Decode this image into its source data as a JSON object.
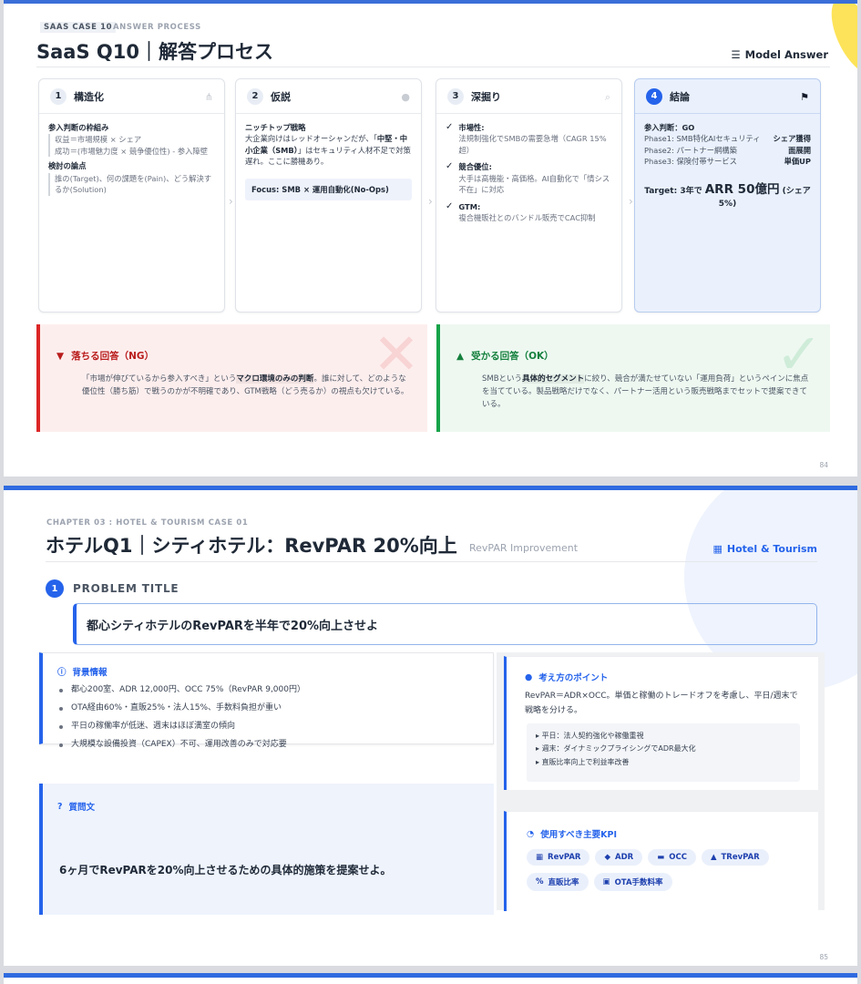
{
  "slide1": {
    "kicker_a": "SAAS CASE 10",
    "kicker_b": "ANSWER PROCESS",
    "title": "SaaS Q10｜解答プロセス",
    "model_answer": "Model Answer",
    "cards": [
      {
        "num": "1",
        "title": "構造化",
        "icon": "sitemap-icon"
      },
      {
        "num": "2",
        "title": "仮説",
        "icon": "lightbulb-icon"
      },
      {
        "num": "3",
        "title": "深掘り",
        "icon": "search-icon"
      },
      {
        "num": "4",
        "title": "結論",
        "icon": "flag-icon"
      }
    ],
    "c1": {
      "h1": "参入判断の枠組み",
      "l1": "収益＝市場規模 × シェア",
      "l2": "成功＝(市場魅力度 × 競争優位性) - 参入障壁",
      "h2": "検討の論点",
      "l3": "誰の(Target)、何の課題を(Pain)、どう解決するか(Solution)"
    },
    "c2": {
      "h1": "ニッチトップ戦略",
      "text_a": "大企業向けはレッドオーシャンだが、「",
      "text_b": "中堅・中小企業（SMB）",
      "text_c": "」はセキュリティ人材不足で対策遅れ。ここに勝機あり。",
      "focus": "Focus: SMB × 運用自動化(No-Ops)"
    },
    "c3": {
      "items": [
        {
          "title": "市場性:",
          "text": "法規制強化でSMBの需要急増（CAGR 15%超）"
        },
        {
          "title": "競合優位:",
          "text": "大手は高機能・高価格。AI自動化で「情シス不在」に対応"
        },
        {
          "title": "GTM:",
          "text": "複合機販社とのバンドル販売でCAC抑制"
        }
      ]
    },
    "c4": {
      "decision": "参入判断：GO",
      "phases": [
        {
          "label": "Phase1: SMB特化AIセキュリティ",
          "value": "シェア獲得"
        },
        {
          "label": "Phase2: パートナー網構築",
          "value": "面展開"
        },
        {
          "label": "Phase3: 保険付帯サービス",
          "value": "単価UP"
        }
      ],
      "target_pre": "Target: 3年で",
      "target_big": "ARR 50億円",
      "target_post": "(シェア5%)"
    },
    "ng": {
      "title": "落ちる回答（NG）",
      "text_a": "「市場が伸びているから参入すべき」という",
      "text_b": "マクロ環境のみの判断",
      "text_c": "。誰に対して、どのような優位性（勝ち筋）で戦うのかが不明確であり、GTM戦略（どう売るか）の視点も欠けている。"
    },
    "ok": {
      "title": "受かる回答（OK）",
      "text_a": "SMBという",
      "text_b": "具体的セグメント",
      "text_c": "に絞り、競合が満たせていない「運用負荷」というペインに焦点を当てている。製品戦略だけでなく、パートナー活用という販売戦略までセットで提案できている。"
    },
    "page": "84"
  },
  "slide2": {
    "kicker": "CHAPTER 03 : HOTEL & TOURISM CASE 01",
    "title": "ホテルQ1｜シティホテル：RevPAR 20%向上",
    "subtitle": "RevPAR Improvement",
    "tag": "Hotel & Tourism",
    "problem_num": "1",
    "problem_label": "PROBLEM TITLE",
    "problem_text": "都心シティホテルのRevPARを半年で20%向上させよ",
    "background": {
      "title": "背景情報",
      "items": [
        "都心200室、ADR 12,000円、OCC 75%（RevPAR 9,000円）",
        "OTA経由60%・直販25%・法人15%、手数料負担が重い",
        "平日の稼働率が低迷、週末はほぼ満室の傾向",
        "大規模な設備投資（CAPEX）不可、運用改善のみで対応要"
      ]
    },
    "question": {
      "title": "質問文",
      "text": "6ヶ月でRevPARを20%向上させるための具体的施策を提案せよ。"
    },
    "idea": {
      "title": "考え方のポイント",
      "text": "RevPAR＝ADR×OCC。単価と稼働のトレードオフを考慮し、平日/週末で戦略を分ける。",
      "sub": [
        "平日：法人契約強化や稼働重視",
        "週末：ダイナミックプライシングでADR最大化",
        "直販比率向上で利益率改善"
      ]
    },
    "kpi": {
      "title": "使用すべき主要KPI",
      "chips": [
        {
          "icon": "building-icon",
          "glyph": "▦",
          "label": "RevPAR"
        },
        {
          "icon": "tag-icon",
          "glyph": "◆",
          "label": "ADR"
        },
        {
          "icon": "bed-icon",
          "glyph": "▬",
          "label": "OCC"
        },
        {
          "icon": "bell-icon",
          "glyph": "▲",
          "label": "TRevPAR"
        },
        {
          "icon": "percent-icon",
          "glyph": "%",
          "label": "直販比率"
        },
        {
          "icon": "money-icon",
          "glyph": "▣",
          "label": "OTA手数料率"
        }
      ]
    },
    "page": "85"
  }
}
